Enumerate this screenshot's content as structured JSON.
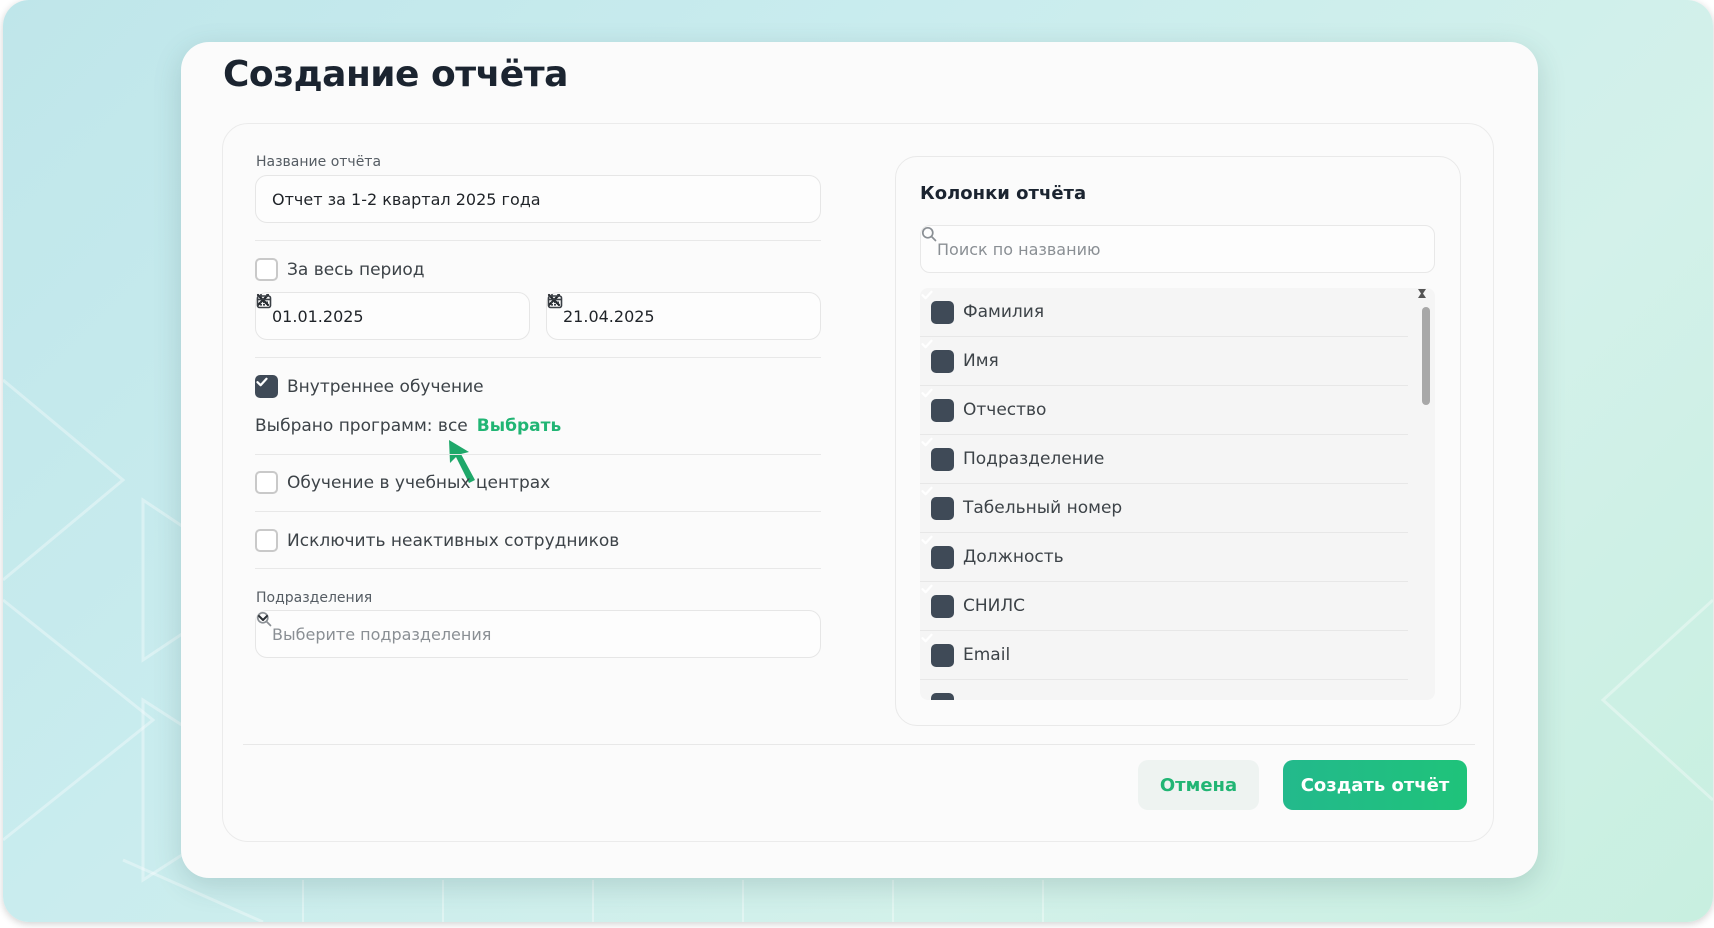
{
  "modal": {
    "title": "Создание отчёта"
  },
  "form": {
    "report_name_label": "Название отчёта",
    "report_name_value": "Отчет за 1-2 квартал 2025 года",
    "whole_period_label": "За весь период",
    "whole_period_checked": false,
    "date_from": "01.01.2025",
    "date_to": "21.04.2025",
    "internal_training_label": "Внутреннее обучение",
    "internal_training_checked": true,
    "programs_selected_text": "Выбрано программ: все",
    "programs_select_link": "Выбрать",
    "training_centers_label": "Обучение в учебных центрах",
    "training_centers_checked": false,
    "exclude_inactive_label": "Исключить неактивных сотрудников",
    "exclude_inactive_checked": false,
    "departments_label": "Подразделения",
    "departments_placeholder": "Выберите подразделения"
  },
  "columns": {
    "title": "Колонки отчёта",
    "search_placeholder": "Поиск по названию",
    "items": [
      {
        "label": "Фамилия",
        "checked": true
      },
      {
        "label": "Имя",
        "checked": true
      },
      {
        "label": "Отчество",
        "checked": true
      },
      {
        "label": "Подразделение",
        "checked": true
      },
      {
        "label": "Табельный номер",
        "checked": true
      },
      {
        "label": "Должность",
        "checked": true
      },
      {
        "label": "СНИЛС",
        "checked": true
      },
      {
        "label": "Email",
        "checked": true
      }
    ]
  },
  "footer": {
    "cancel_label": "Отмена",
    "create_label": "Создать отчёт"
  },
  "colors": {
    "accent_green": "#21b574",
    "checkbox_dark": "#3f4a57",
    "arrow_green": "#1fa86a"
  },
  "icons": [
    "clear-icon",
    "calendar-icon",
    "search-icon",
    "chevron-down-icon",
    "check-icon",
    "scroll-up-icon",
    "scroll-down-icon",
    "pointer-arrow-icon"
  ]
}
